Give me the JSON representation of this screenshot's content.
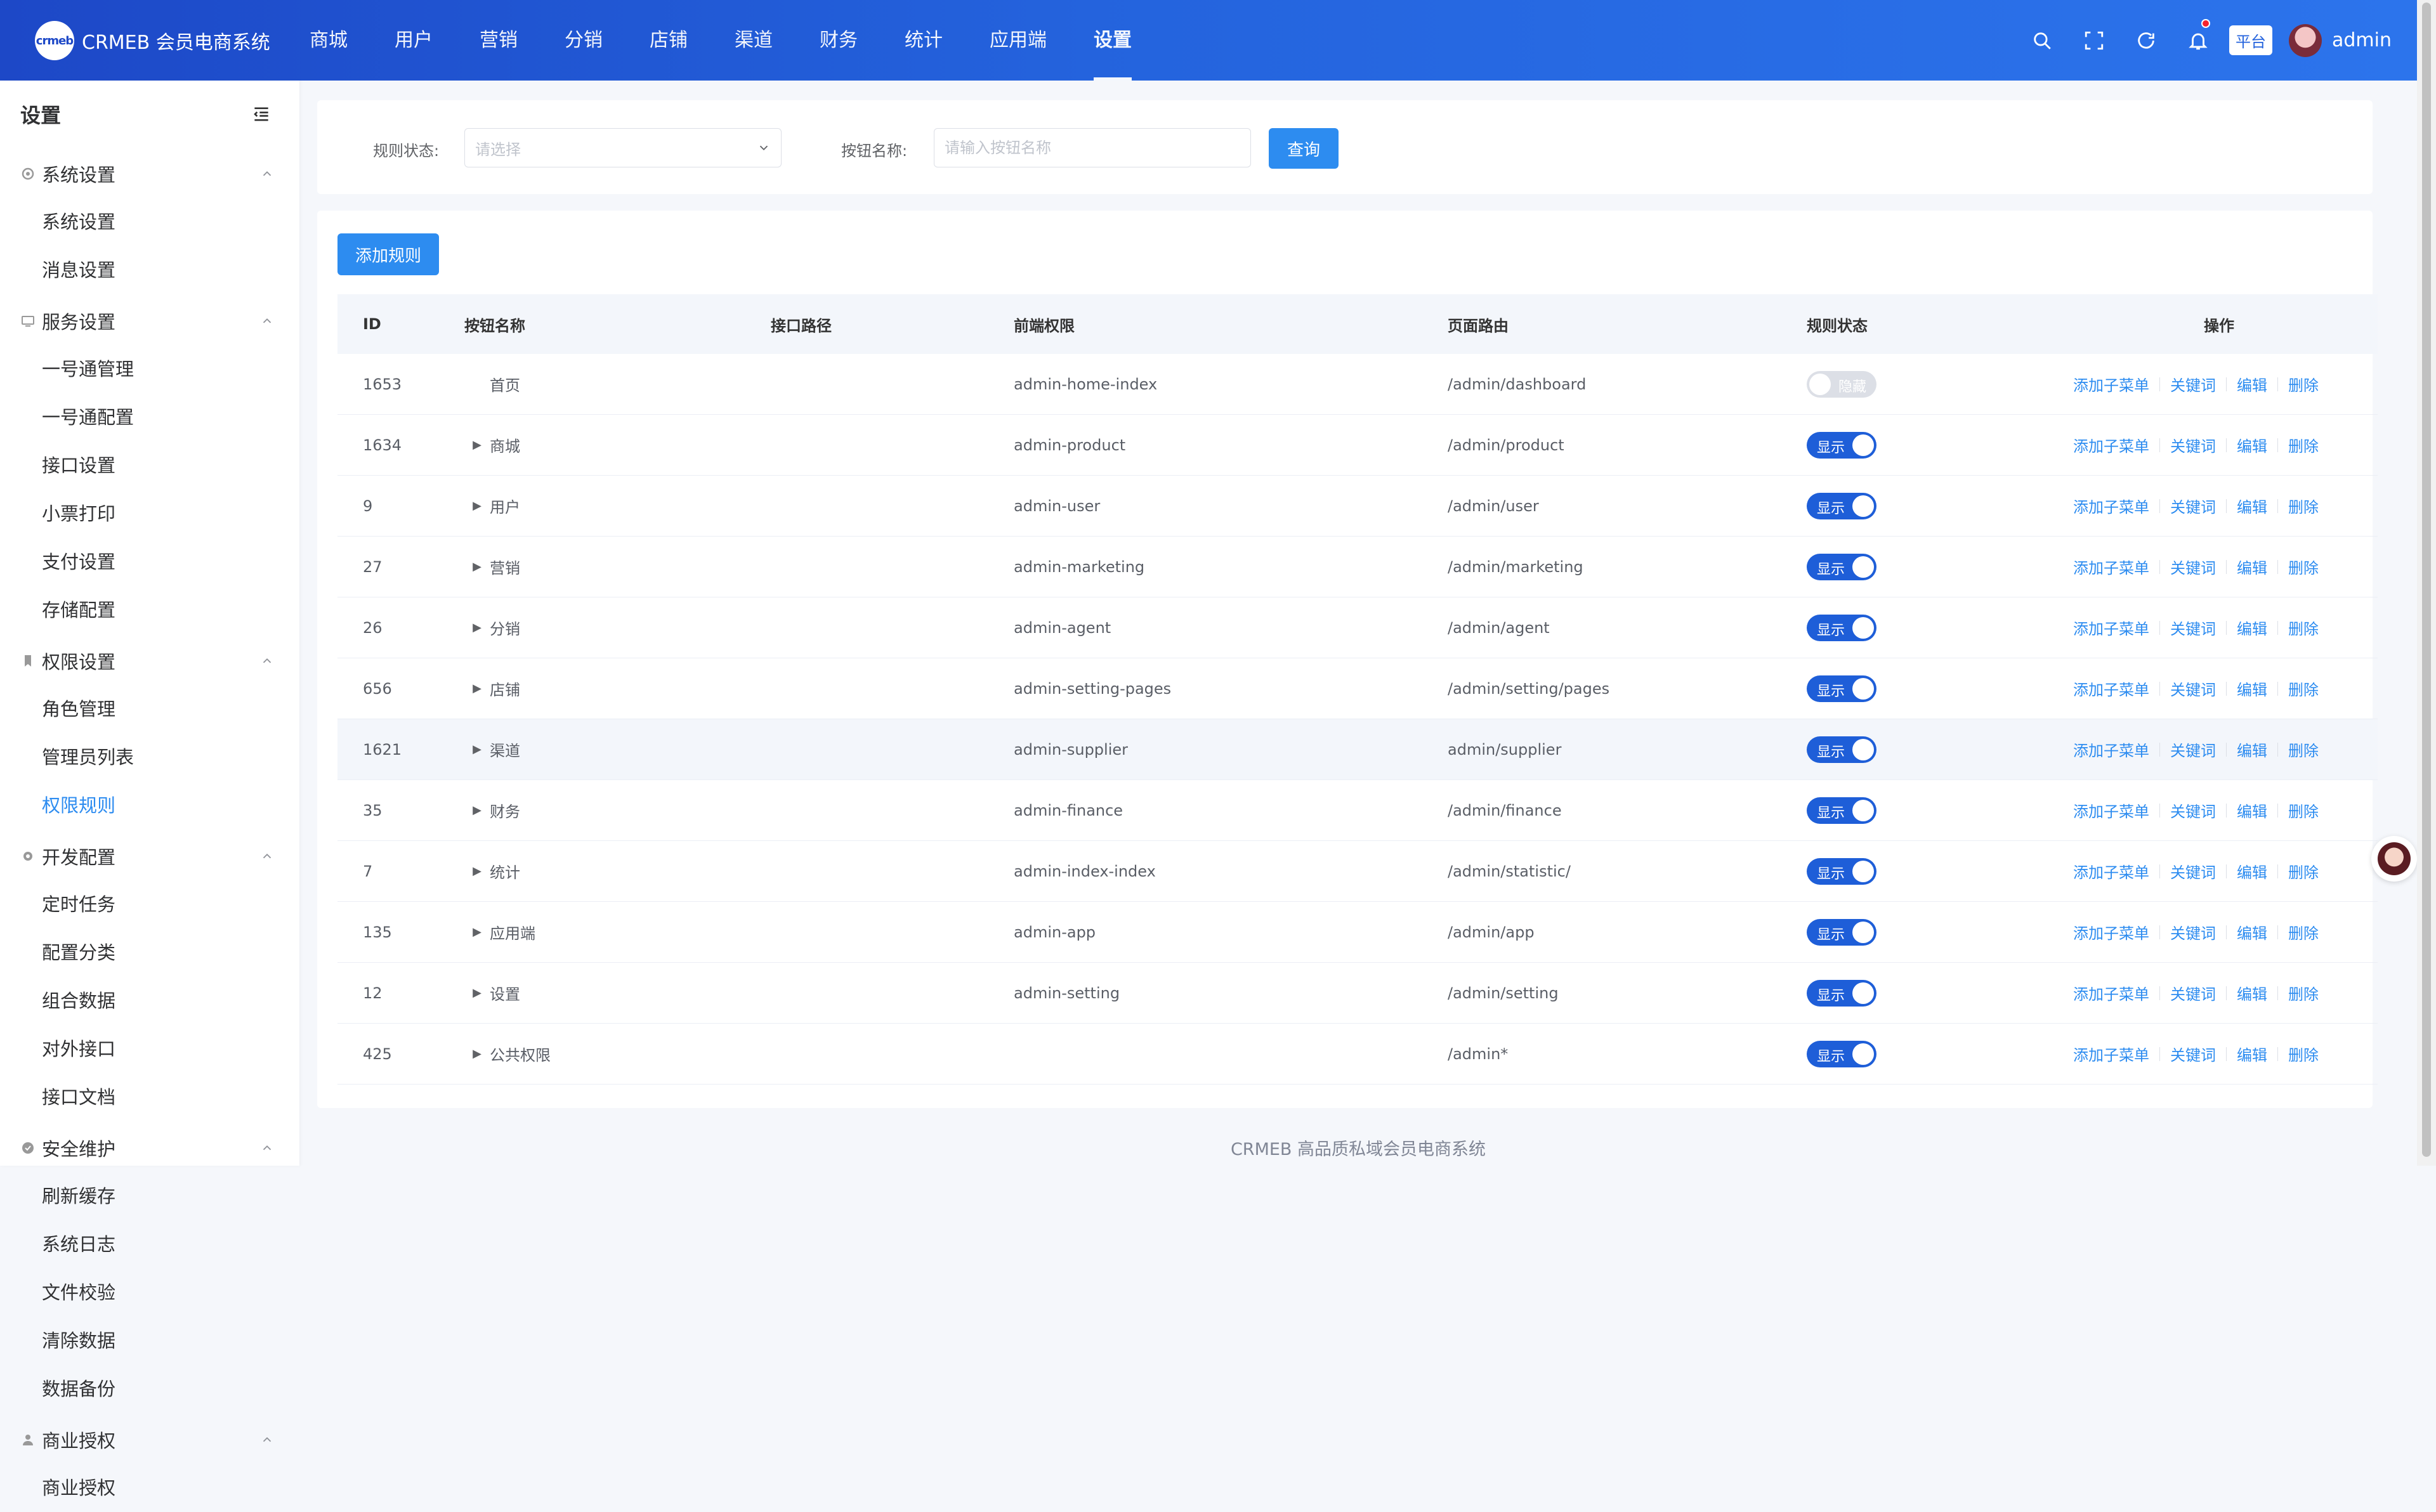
{
  "brand": {
    "logo_text": "crmeb",
    "title": "CRMEB 会员电商系统"
  },
  "topnav": [
    "商城",
    "用户",
    "营销",
    "分销",
    "店铺",
    "渠道",
    "财务",
    "统计",
    "应用端",
    "设置"
  ],
  "topnav_active_index": 9,
  "header": {
    "platform": "平台",
    "username": "admin"
  },
  "sidebar": {
    "title": "设置",
    "groups": [
      {
        "title": "系统设置",
        "icon": "gear-icon",
        "items": [
          "系统设置",
          "消息设置"
        ]
      },
      {
        "title": "服务设置",
        "icon": "monitor-icon",
        "items": [
          "一号通管理",
          "一号通配置",
          "接口设置",
          "小票打印",
          "支付设置",
          "存储配置"
        ]
      },
      {
        "title": "权限设置",
        "icon": "bookmark-icon",
        "items": [
          "角色管理",
          "管理员列表",
          "权限规则"
        ]
      },
      {
        "title": "开发配置",
        "icon": "cog-icon",
        "items": [
          "定时任务",
          "配置分类",
          "组合数据",
          "对外接口",
          "接口文档"
        ]
      },
      {
        "title": "安全维护",
        "icon": "check-circle-icon",
        "items": [
          "刷新缓存",
          "系统日志",
          "文件校验",
          "清除数据",
          "数据备份"
        ]
      },
      {
        "title": "商业授权",
        "icon": "user-icon",
        "items": [
          "商业授权"
        ]
      }
    ],
    "active_item": "权限规则"
  },
  "filter": {
    "status_label": "规则状态:",
    "status_placeholder": "请选择",
    "name_label": "按钮名称:",
    "name_placeholder": "请输入按钮名称",
    "query_button": "查询"
  },
  "table": {
    "add_button": "添加规则",
    "headers": {
      "id": "ID",
      "name": "按钮名称",
      "path": "接口路径",
      "perm": "前端权限",
      "route": "页面路由",
      "status": "规则状态",
      "ops": "操作"
    },
    "ops": [
      "添加子菜单",
      "关键词",
      "编辑",
      "删除"
    ],
    "status_on": "显示",
    "status_off": "隐藏",
    "rows": [
      {
        "id": "1653",
        "name": "首页",
        "expandable": false,
        "path": "",
        "perm": "admin-home-index",
        "route": "/admin/dashboard",
        "on": false
      },
      {
        "id": "1634",
        "name": "商城",
        "expandable": true,
        "path": "",
        "perm": "admin-product",
        "route": "/admin/product",
        "on": true
      },
      {
        "id": "9",
        "name": "用户",
        "expandable": true,
        "path": "",
        "perm": "admin-user",
        "route": "/admin/user",
        "on": true
      },
      {
        "id": "27",
        "name": "营销",
        "expandable": true,
        "path": "",
        "perm": "admin-marketing",
        "route": "/admin/marketing",
        "on": true
      },
      {
        "id": "26",
        "name": "分销",
        "expandable": true,
        "path": "",
        "perm": "admin-agent",
        "route": "/admin/agent",
        "on": true
      },
      {
        "id": "656",
        "name": "店铺",
        "expandable": true,
        "path": "",
        "perm": "admin-setting-pages",
        "route": "/admin/setting/pages",
        "on": true
      },
      {
        "id": "1621",
        "name": "渠道",
        "expandable": true,
        "path": "",
        "perm": "admin-supplier",
        "route": "admin/supplier",
        "on": true
      },
      {
        "id": "35",
        "name": "财务",
        "expandable": true,
        "path": "",
        "perm": "admin-finance",
        "route": "/admin/finance",
        "on": true
      },
      {
        "id": "7",
        "name": "统计",
        "expandable": true,
        "path": "",
        "perm": "admin-index-index",
        "route": "/admin/statistic/",
        "on": true
      },
      {
        "id": "135",
        "name": "应用端",
        "expandable": true,
        "path": "",
        "perm": "admin-app",
        "route": "/admin/app",
        "on": true
      },
      {
        "id": "12",
        "name": "设置",
        "expandable": true,
        "path": "",
        "perm": "admin-setting",
        "route": "/admin/setting",
        "on": true
      },
      {
        "id": "425",
        "name": "公共权限",
        "expandable": true,
        "path": "",
        "perm": "",
        "route": "/admin*",
        "on": true
      }
    ],
    "highlight_row": 6
  },
  "footer": "CRMEB 高品质私域会员电商系统",
  "colors": {
    "primary": "#2d8cf0",
    "header_start": "#1d48c7",
    "header_end": "#2c74ec",
    "switch_on": "#1e5ed8"
  }
}
